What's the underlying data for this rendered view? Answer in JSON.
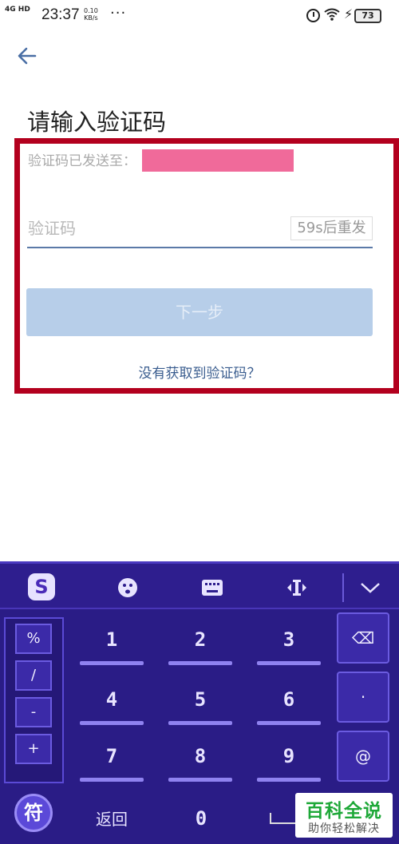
{
  "statusbar": {
    "network": "4G HD",
    "time": "23:37",
    "speed_value": "0.10",
    "speed_unit": "KB/s",
    "more": "···",
    "battery": "73"
  },
  "page": {
    "title": "请输入验证码",
    "sent_label": "验证码已发送至：",
    "code_placeholder": "验证码",
    "resend": "59s后重发",
    "next_button": "下一步",
    "no_code_link": "没有获取到验证码？",
    "back_icon": "arrow-left-icon"
  },
  "keyboard": {
    "toolbar_icons": [
      "sogou-logo-icon",
      "emoji-icon",
      "keyboard-icon",
      "cursor-icon",
      "collapse-icon"
    ],
    "sogou_label": "S",
    "side_keys": [
      "%",
      "/",
      "-",
      "+"
    ],
    "number_keys": [
      "1",
      "2",
      "3",
      "4",
      "5",
      "6",
      "7",
      "8",
      "9"
    ],
    "right_keys": [
      "⌫",
      "·",
      "@"
    ],
    "symbol_key": "符",
    "return_key": "返回",
    "zero_key": "0"
  },
  "watermark": {
    "line1": "百科全说",
    "line2": "助你轻松解决"
  },
  "colors": {
    "highlight_border": "#b3001e",
    "accent_blue": "#3a5d8f",
    "keyboard_bg": "#2a1c86",
    "mask": "#f06a9a"
  }
}
